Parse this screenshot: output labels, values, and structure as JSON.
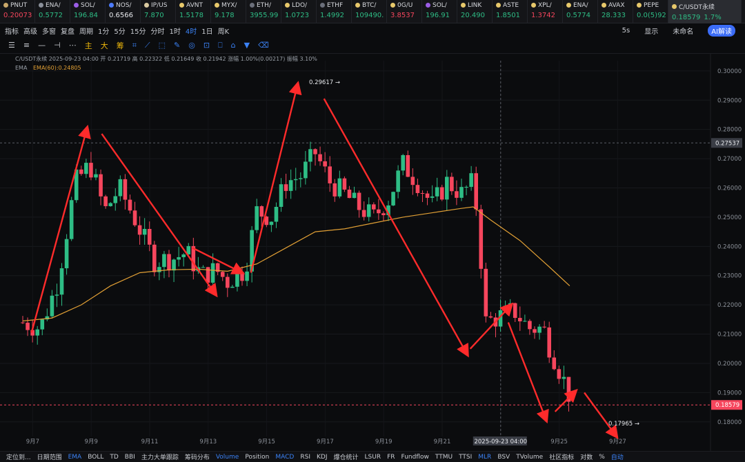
{
  "ticker": [
    {
      "name": "PNUT",
      "price": "0.20073",
      "dir": "dn",
      "dot": "#c9a86a"
    },
    {
      "name": "ENA/",
      "price": "0.5772",
      "dir": "up",
      "dot": "#8a8f99"
    },
    {
      "name": "SOL/",
      "price": "196.84",
      "dir": "up",
      "dot": "#9b5de5"
    },
    {
      "name": "NOS/",
      "price": "0.6566",
      "dir": "wh",
      "dot": "#4d7cfe"
    },
    {
      "name": "IP/US",
      "price": "7.870",
      "dir": "up",
      "dot": "#d9c9a0"
    },
    {
      "name": "AVNT",
      "price": "1.5178",
      "dir": "up",
      "dot": "#e7c86b"
    },
    {
      "name": "MYX/",
      "price": "9.178",
      "dir": "up",
      "dot": "#e7c86b"
    },
    {
      "name": "ETH/",
      "price": "3955.99",
      "dir": "up",
      "dot": "#6b6f7a"
    },
    {
      "name": "LDO/",
      "price": "1.0723",
      "dir": "up",
      "dot": "#e7c86b"
    },
    {
      "name": "ETHF",
      "price": "1.4992",
      "dir": "up",
      "dot": "#6b6f7a"
    },
    {
      "name": "BTC/",
      "price": "109490.",
      "dir": "up",
      "dot": "#e7c86b"
    },
    {
      "name": "0G/U",
      "price": "3.8537",
      "dir": "dn",
      "dot": "#e7c86b"
    },
    {
      "name": "SOL/",
      "price": "196.91",
      "dir": "up",
      "dot": "#9b5de5"
    },
    {
      "name": "LINK",
      "price": "20.490",
      "dir": "up",
      "dot": "#e7c86b"
    },
    {
      "name": "ASTE",
      "price": "1.8501",
      "dir": "up",
      "dot": "#e7c86b"
    },
    {
      "name": "XPL/",
      "price": "1.3742",
      "dir": "dn",
      "dot": "#e7c86b"
    },
    {
      "name": "ENA/",
      "price": "0.5774",
      "dir": "up",
      "dot": "#e7c86b"
    },
    {
      "name": "AVAX",
      "price": "28.333",
      "dir": "up",
      "dot": "#e7c86b"
    },
    {
      "name": "PEPE",
      "price": "0.0(5)92",
      "dir": "up",
      "dot": "#e7c86b"
    }
  ],
  "active": {
    "name": "C/USDT永续",
    "price": "0.18579",
    "change": "1.7%"
  },
  "toolbar": {
    "items": [
      "指标",
      "高级",
      "多窗",
      "复盘",
      "周期",
      "1分",
      "5分",
      "15分",
      "分时",
      "1时",
      "4时",
      "1日",
      "周K"
    ],
    "active": "4时",
    "right": [
      "5s",
      "显示",
      "未命名",
      "AI解读"
    ]
  },
  "drawbar": [
    "主",
    "大",
    "筹"
  ],
  "info": {
    "line1": "C/USDT永续  2025-09-23 04:00  开 0.21719  高 0.22322  低 0.21649  收 0.21942  涨幅 1.00%(0.00217)  振幅 3.10%",
    "ema": "EMA",
    "ema60": "EMA(60):0.24805"
  },
  "chart_data": {
    "type": "candlestick",
    "x_labels": [
      "9月7",
      "9月9",
      "9月11",
      "9月13",
      "9月15",
      "9月17",
      "9月19",
      "9月21",
      "2025-09-23 04:00",
      "9月25",
      "9月27"
    ],
    "y_ticks": [
      0.3,
      0.29,
      0.28,
      0.27,
      0.26,
      0.25,
      0.24,
      0.23,
      0.22,
      0.21,
      0.2,
      0.19,
      0.18
    ],
    "ylim": [
      0.175,
      0.3035
    ],
    "high_label": "0.29617",
    "low_label": "0.17965",
    "crosshair_price": "0.27537",
    "last_price": "0.18579",
    "colors": {
      "up": "#2ebd85",
      "down": "#f6465d",
      "ema": "#e2a035",
      "arrow": "#ff2b2b"
    },
    "arrows": [
      {
        "from": [
          6.3,
          0.2105
        ],
        "to": [
          8.2,
          0.2805
        ]
      },
      {
        "from": [
          8.7,
          0.2785
        ],
        "to": [
          12.6,
          0.2235
        ]
      },
      {
        "from": [
          11.8,
          0.2395
        ],
        "to": [
          13.5,
          0.231
        ]
      },
      {
        "from": [
          13.8,
          0.231
        ],
        "to": [
          15.4,
          0.2955
        ]
      },
      {
        "from": [
          16.3,
          0.2905
        ],
        "to": [
          21.2,
          0.203
        ]
      },
      {
        "from": [
          21.3,
          0.205
        ],
        "to": [
          22.7,
          0.22
        ]
      },
      {
        "from": [
          22.6,
          0.214
        ],
        "to": [
          23.9,
          0.1805
        ]
      },
      {
        "from": [
          24.2,
          0.1835
        ],
        "to": [
          24.9,
          0.1905
        ]
      },
      {
        "from": [
          25.2,
          0.19
        ],
        "to": [
          26.3,
          0.175
        ]
      }
    ],
    "ema": [
      [
        6.0,
        0.2145
      ],
      [
        7.0,
        0.2155
      ],
      [
        8.0,
        0.22
      ],
      [
        9.0,
        0.2265
      ],
      [
        10.0,
        0.231
      ],
      [
        11.0,
        0.232
      ],
      [
        12.0,
        0.2322
      ],
      [
        13.0,
        0.2315
      ],
      [
        14.0,
        0.234
      ],
      [
        15.0,
        0.2395
      ],
      [
        16.0,
        0.245
      ],
      [
        17.0,
        0.246
      ],
      [
        18.0,
        0.248
      ],
      [
        19.0,
        0.25
      ],
      [
        20.0,
        0.2515
      ],
      [
        21.0,
        0.253
      ],
      [
        21.4,
        0.2535
      ],
      [
        22.0,
        0.249
      ],
      [
        23.0,
        0.242
      ],
      [
        24.0,
        0.233
      ],
      [
        24.7,
        0.2265
      ]
    ]
  },
  "bottom": [
    "定位到...",
    "日期范围",
    "EMA",
    "BOLL",
    "TD",
    "BBI",
    "主力大单跟踪",
    "筹码分布",
    "Volume",
    "Position",
    "MACD",
    "RSI",
    "KDJ",
    "爆仓统计",
    "LSUR",
    "FR",
    "Fundflow",
    "TTMU",
    "TTSI",
    "MLR",
    "BSV",
    "TVolume",
    "社区指标",
    "对数",
    "%",
    "自动"
  ],
  "bottom_active": [
    "EMA",
    "Volume",
    "MACD",
    "MLR",
    "自动"
  ]
}
